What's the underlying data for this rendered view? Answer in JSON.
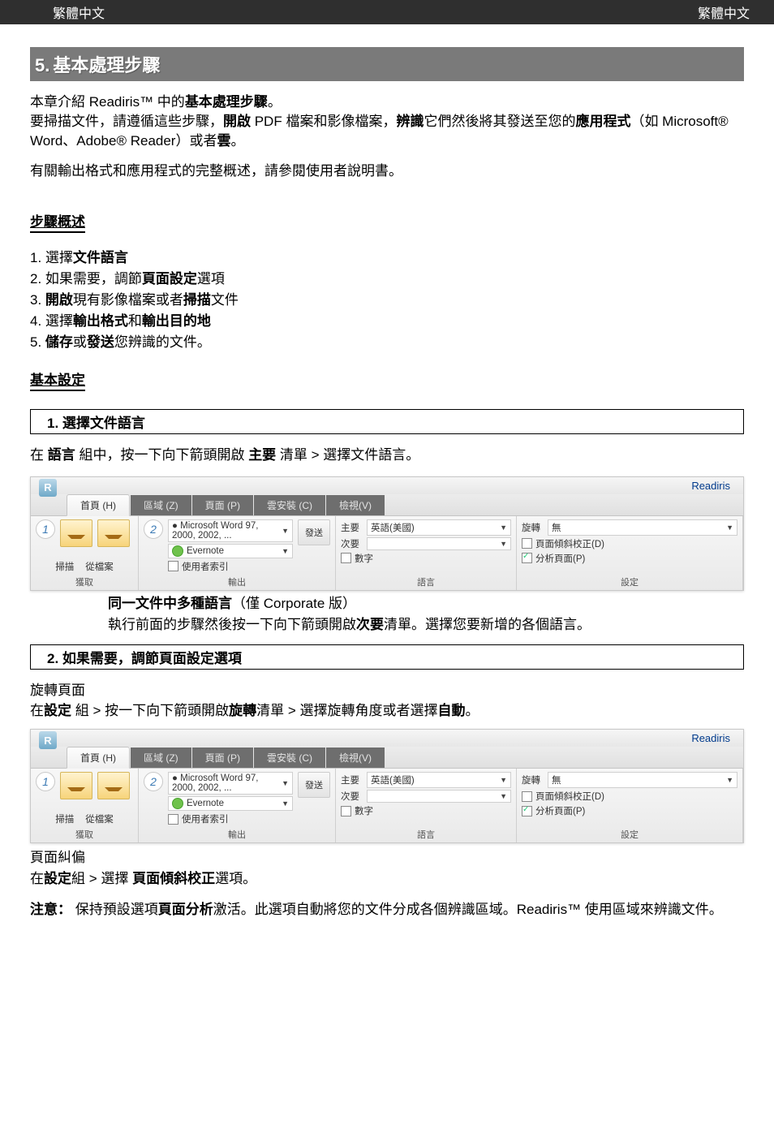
{
  "header": {
    "left": "繁體中文",
    "right": "繁體中文"
  },
  "section": {
    "number": "5.",
    "title": "基本處理步驟"
  },
  "intro": {
    "p1_a": "本章介紹 Readiris™ 中的",
    "p1_b": "基本處理步驟",
    "p1_c": "。",
    "p2_a": "要掃描文件，請遵循這些步驟，",
    "p2_b": "開啟",
    "p2_c": " PDF 檔案和影像檔案，",
    "p2_d": "辨識",
    "p2_e": "它們然後將其發送至您的",
    "p2_f": "應用程式",
    "p2_g": "（如 Microsoft® Word、Adobe® Reader）或者",
    "p2_h": "雲",
    "p2_i": "。",
    "p3": "有關輸出格式和應用程式的完整概述，請參閱使用者說明書。"
  },
  "overview_heading": "步驟概述",
  "steps": [
    {
      "n": "1.",
      "a": "選擇",
      "b": "文件語言",
      "c": ""
    },
    {
      "n": "2.",
      "a": "如果需要，調節",
      "b": "頁面設定",
      "c": "選項"
    },
    {
      "n": "3.",
      "a": "",
      "b": "開啟",
      "c": "現有影像檔案或者",
      "d": "掃描",
      "e": "文件"
    },
    {
      "n": "4.",
      "a": "選擇",
      "b": "輸出格式",
      "c": "和",
      "d": "輸出目的地",
      "e": ""
    },
    {
      "n": "5.",
      "a": "",
      "b": "儲存",
      "c": "或",
      "d": "發送",
      "e": "您辨識的文件。"
    }
  ],
  "basic_heading": "基本設定",
  "box1": "1. 選擇文件語言",
  "lang_instr_a": "在 ",
  "lang_instr_b": "語言",
  "lang_instr_c": " 組中，按一下向下箭頭開啟 ",
  "lang_instr_d": "主要",
  "lang_instr_e": " 清單 > 選擇文件語言。",
  "ribbon": {
    "app": "Readiris",
    "tabs": {
      "home": "首頁 (H)",
      "zone": "區域 (Z)",
      "page": "頁面 (P)",
      "cloud": "雲安裝 (C)",
      "view": "檢視(V)"
    },
    "acquire": {
      "scan": "掃描",
      "fromfile": "從檔案",
      "label": "獲取"
    },
    "output": {
      "format": "Microsoft Word 97, 2000, 2002, ...",
      "target": "Evernote",
      "index_chk": "使用者索引",
      "send": "發送",
      "label": "輸出"
    },
    "language": {
      "primary_lbl": "主要",
      "primary_val": "英語(美國)",
      "secondary_lbl": "次要",
      "numbers_chk": "數字",
      "label": "語言"
    },
    "settings": {
      "rotate_lbl": "旋轉",
      "rotate_val": "無",
      "deskew_chk": "頁面傾斜校正(D)",
      "analyze_chk": "分析頁面(P)",
      "label": "設定"
    }
  },
  "multi_lang": {
    "h_a": "同一文件中多種語言",
    "h_b": "（僅 Corporate 版）",
    "p_a": "執行前面的步驟然後按一下向下箭頭開啟",
    "p_b": "次要",
    "p_c": "清單。選擇您要新增的各個語言。"
  },
  "box2": "2. 如果需要，調節頁面設定選項",
  "rotate": {
    "h": "旋轉頁面",
    "p_a": "在",
    "p_b": "設定",
    "p_c": " 組 > 按一下向下箭頭開啟",
    "p_d": "旋轉",
    "p_e": "清單 > 選擇旋轉角度或者選擇",
    "p_f": "自動",
    "p_g": "。"
  },
  "deskew": {
    "h": "頁面糾偏",
    "p_a": "在",
    "p_b": "設定",
    "p_c": "組 > 選擇 ",
    "p_d": "頁面傾斜校正",
    "p_e": "選項。"
  },
  "note": {
    "a": "注意：",
    "b": "保持預設選項",
    "c": "頁面分析",
    "d": "激活。此選項自動將您的文件分成各個辨識區域。Readiris™ 使用區域來辨識文件。"
  }
}
